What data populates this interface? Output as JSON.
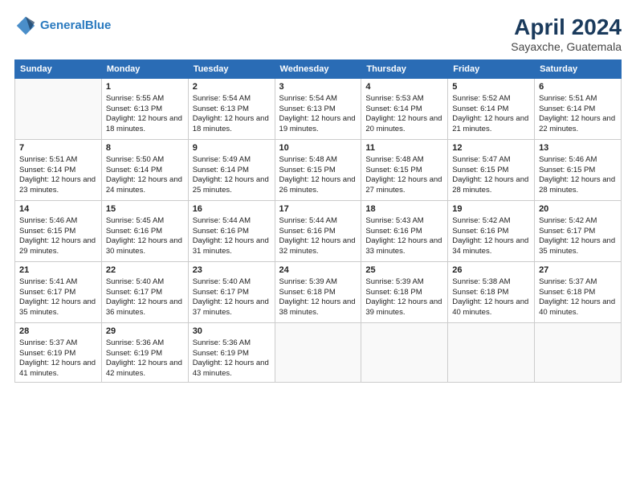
{
  "header": {
    "logo_line1": "General",
    "logo_line2": "Blue",
    "month_year": "April 2024",
    "location": "Sayaxche, Guatemala"
  },
  "days_of_week": [
    "Sunday",
    "Monday",
    "Tuesday",
    "Wednesday",
    "Thursday",
    "Friday",
    "Saturday"
  ],
  "weeks": [
    [
      {
        "day": "",
        "empty": true
      },
      {
        "day": "1",
        "sunrise": "Sunrise: 5:55 AM",
        "sunset": "Sunset: 6:13 PM",
        "daylight": "Daylight: 12 hours and 18 minutes."
      },
      {
        "day": "2",
        "sunrise": "Sunrise: 5:54 AM",
        "sunset": "Sunset: 6:13 PM",
        "daylight": "Daylight: 12 hours and 18 minutes."
      },
      {
        "day": "3",
        "sunrise": "Sunrise: 5:54 AM",
        "sunset": "Sunset: 6:13 PM",
        "daylight": "Daylight: 12 hours and 19 minutes."
      },
      {
        "day": "4",
        "sunrise": "Sunrise: 5:53 AM",
        "sunset": "Sunset: 6:14 PM",
        "daylight": "Daylight: 12 hours and 20 minutes."
      },
      {
        "day": "5",
        "sunrise": "Sunrise: 5:52 AM",
        "sunset": "Sunset: 6:14 PM",
        "daylight": "Daylight: 12 hours and 21 minutes."
      },
      {
        "day": "6",
        "sunrise": "Sunrise: 5:51 AM",
        "sunset": "Sunset: 6:14 PM",
        "daylight": "Daylight: 12 hours and 22 minutes."
      }
    ],
    [
      {
        "day": "7",
        "sunrise": "Sunrise: 5:51 AM",
        "sunset": "Sunset: 6:14 PM",
        "daylight": "Daylight: 12 hours and 23 minutes."
      },
      {
        "day": "8",
        "sunrise": "Sunrise: 5:50 AM",
        "sunset": "Sunset: 6:14 PM",
        "daylight": "Daylight: 12 hours and 24 minutes."
      },
      {
        "day": "9",
        "sunrise": "Sunrise: 5:49 AM",
        "sunset": "Sunset: 6:14 PM",
        "daylight": "Daylight: 12 hours and 25 minutes."
      },
      {
        "day": "10",
        "sunrise": "Sunrise: 5:48 AM",
        "sunset": "Sunset: 6:15 PM",
        "daylight": "Daylight: 12 hours and 26 minutes."
      },
      {
        "day": "11",
        "sunrise": "Sunrise: 5:48 AM",
        "sunset": "Sunset: 6:15 PM",
        "daylight": "Daylight: 12 hours and 27 minutes."
      },
      {
        "day": "12",
        "sunrise": "Sunrise: 5:47 AM",
        "sunset": "Sunset: 6:15 PM",
        "daylight": "Daylight: 12 hours and 28 minutes."
      },
      {
        "day": "13",
        "sunrise": "Sunrise: 5:46 AM",
        "sunset": "Sunset: 6:15 PM",
        "daylight": "Daylight: 12 hours and 28 minutes."
      }
    ],
    [
      {
        "day": "14",
        "sunrise": "Sunrise: 5:46 AM",
        "sunset": "Sunset: 6:15 PM",
        "daylight": "Daylight: 12 hours and 29 minutes."
      },
      {
        "day": "15",
        "sunrise": "Sunrise: 5:45 AM",
        "sunset": "Sunset: 6:16 PM",
        "daylight": "Daylight: 12 hours and 30 minutes."
      },
      {
        "day": "16",
        "sunrise": "Sunrise: 5:44 AM",
        "sunset": "Sunset: 6:16 PM",
        "daylight": "Daylight: 12 hours and 31 minutes."
      },
      {
        "day": "17",
        "sunrise": "Sunrise: 5:44 AM",
        "sunset": "Sunset: 6:16 PM",
        "daylight": "Daylight: 12 hours and 32 minutes."
      },
      {
        "day": "18",
        "sunrise": "Sunrise: 5:43 AM",
        "sunset": "Sunset: 6:16 PM",
        "daylight": "Daylight: 12 hours and 33 minutes."
      },
      {
        "day": "19",
        "sunrise": "Sunrise: 5:42 AM",
        "sunset": "Sunset: 6:16 PM",
        "daylight": "Daylight: 12 hours and 34 minutes."
      },
      {
        "day": "20",
        "sunrise": "Sunrise: 5:42 AM",
        "sunset": "Sunset: 6:17 PM",
        "daylight": "Daylight: 12 hours and 35 minutes."
      }
    ],
    [
      {
        "day": "21",
        "sunrise": "Sunrise: 5:41 AM",
        "sunset": "Sunset: 6:17 PM",
        "daylight": "Daylight: 12 hours and 35 minutes."
      },
      {
        "day": "22",
        "sunrise": "Sunrise: 5:40 AM",
        "sunset": "Sunset: 6:17 PM",
        "daylight": "Daylight: 12 hours and 36 minutes."
      },
      {
        "day": "23",
        "sunrise": "Sunrise: 5:40 AM",
        "sunset": "Sunset: 6:17 PM",
        "daylight": "Daylight: 12 hours and 37 minutes."
      },
      {
        "day": "24",
        "sunrise": "Sunrise: 5:39 AM",
        "sunset": "Sunset: 6:18 PM",
        "daylight": "Daylight: 12 hours and 38 minutes."
      },
      {
        "day": "25",
        "sunrise": "Sunrise: 5:39 AM",
        "sunset": "Sunset: 6:18 PM",
        "daylight": "Daylight: 12 hours and 39 minutes."
      },
      {
        "day": "26",
        "sunrise": "Sunrise: 5:38 AM",
        "sunset": "Sunset: 6:18 PM",
        "daylight": "Daylight: 12 hours and 40 minutes."
      },
      {
        "day": "27",
        "sunrise": "Sunrise: 5:37 AM",
        "sunset": "Sunset: 6:18 PM",
        "daylight": "Daylight: 12 hours and 40 minutes."
      }
    ],
    [
      {
        "day": "28",
        "sunrise": "Sunrise: 5:37 AM",
        "sunset": "Sunset: 6:19 PM",
        "daylight": "Daylight: 12 hours and 41 minutes."
      },
      {
        "day": "29",
        "sunrise": "Sunrise: 5:36 AM",
        "sunset": "Sunset: 6:19 PM",
        "daylight": "Daylight: 12 hours and 42 minutes."
      },
      {
        "day": "30",
        "sunrise": "Sunrise: 5:36 AM",
        "sunset": "Sunset: 6:19 PM",
        "daylight": "Daylight: 12 hours and 43 minutes."
      },
      {
        "day": "",
        "empty": true
      },
      {
        "day": "",
        "empty": true
      },
      {
        "day": "",
        "empty": true
      },
      {
        "day": "",
        "empty": true
      }
    ]
  ]
}
